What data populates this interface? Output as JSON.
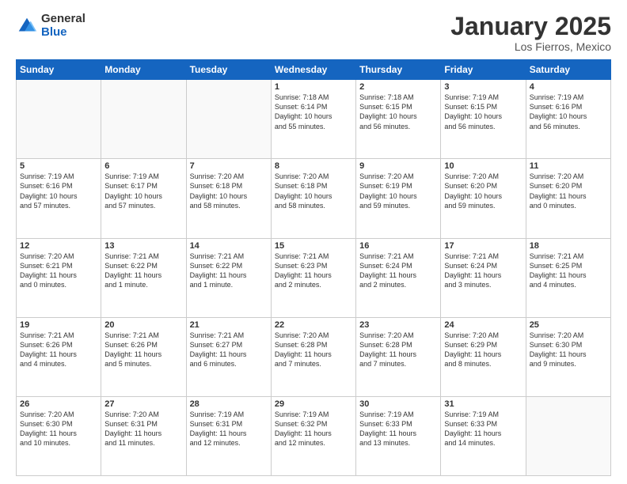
{
  "header": {
    "logo_general": "General",
    "logo_blue": "Blue",
    "month_title": "January 2025",
    "subtitle": "Los Fierros, Mexico"
  },
  "days_of_week": [
    "Sunday",
    "Monday",
    "Tuesday",
    "Wednesday",
    "Thursday",
    "Friday",
    "Saturday"
  ],
  "weeks": [
    [
      {
        "num": "",
        "info": ""
      },
      {
        "num": "",
        "info": ""
      },
      {
        "num": "",
        "info": ""
      },
      {
        "num": "1",
        "info": "Sunrise: 7:18 AM\nSunset: 6:14 PM\nDaylight: 10 hours\nand 55 minutes."
      },
      {
        "num": "2",
        "info": "Sunrise: 7:18 AM\nSunset: 6:15 PM\nDaylight: 10 hours\nand 56 minutes."
      },
      {
        "num": "3",
        "info": "Sunrise: 7:19 AM\nSunset: 6:15 PM\nDaylight: 10 hours\nand 56 minutes."
      },
      {
        "num": "4",
        "info": "Sunrise: 7:19 AM\nSunset: 6:16 PM\nDaylight: 10 hours\nand 56 minutes."
      }
    ],
    [
      {
        "num": "5",
        "info": "Sunrise: 7:19 AM\nSunset: 6:16 PM\nDaylight: 10 hours\nand 57 minutes."
      },
      {
        "num": "6",
        "info": "Sunrise: 7:19 AM\nSunset: 6:17 PM\nDaylight: 10 hours\nand 57 minutes."
      },
      {
        "num": "7",
        "info": "Sunrise: 7:20 AM\nSunset: 6:18 PM\nDaylight: 10 hours\nand 58 minutes."
      },
      {
        "num": "8",
        "info": "Sunrise: 7:20 AM\nSunset: 6:18 PM\nDaylight: 10 hours\nand 58 minutes."
      },
      {
        "num": "9",
        "info": "Sunrise: 7:20 AM\nSunset: 6:19 PM\nDaylight: 10 hours\nand 59 minutes."
      },
      {
        "num": "10",
        "info": "Sunrise: 7:20 AM\nSunset: 6:20 PM\nDaylight: 10 hours\nand 59 minutes."
      },
      {
        "num": "11",
        "info": "Sunrise: 7:20 AM\nSunset: 6:20 PM\nDaylight: 11 hours\nand 0 minutes."
      }
    ],
    [
      {
        "num": "12",
        "info": "Sunrise: 7:20 AM\nSunset: 6:21 PM\nDaylight: 11 hours\nand 0 minutes."
      },
      {
        "num": "13",
        "info": "Sunrise: 7:21 AM\nSunset: 6:22 PM\nDaylight: 11 hours\nand 1 minute."
      },
      {
        "num": "14",
        "info": "Sunrise: 7:21 AM\nSunset: 6:22 PM\nDaylight: 11 hours\nand 1 minute."
      },
      {
        "num": "15",
        "info": "Sunrise: 7:21 AM\nSunset: 6:23 PM\nDaylight: 11 hours\nand 2 minutes."
      },
      {
        "num": "16",
        "info": "Sunrise: 7:21 AM\nSunset: 6:24 PM\nDaylight: 11 hours\nand 2 minutes."
      },
      {
        "num": "17",
        "info": "Sunrise: 7:21 AM\nSunset: 6:24 PM\nDaylight: 11 hours\nand 3 minutes."
      },
      {
        "num": "18",
        "info": "Sunrise: 7:21 AM\nSunset: 6:25 PM\nDaylight: 11 hours\nand 4 minutes."
      }
    ],
    [
      {
        "num": "19",
        "info": "Sunrise: 7:21 AM\nSunset: 6:26 PM\nDaylight: 11 hours\nand 4 minutes."
      },
      {
        "num": "20",
        "info": "Sunrise: 7:21 AM\nSunset: 6:26 PM\nDaylight: 11 hours\nand 5 minutes."
      },
      {
        "num": "21",
        "info": "Sunrise: 7:21 AM\nSunset: 6:27 PM\nDaylight: 11 hours\nand 6 minutes."
      },
      {
        "num": "22",
        "info": "Sunrise: 7:20 AM\nSunset: 6:28 PM\nDaylight: 11 hours\nand 7 minutes."
      },
      {
        "num": "23",
        "info": "Sunrise: 7:20 AM\nSunset: 6:28 PM\nDaylight: 11 hours\nand 7 minutes."
      },
      {
        "num": "24",
        "info": "Sunrise: 7:20 AM\nSunset: 6:29 PM\nDaylight: 11 hours\nand 8 minutes."
      },
      {
        "num": "25",
        "info": "Sunrise: 7:20 AM\nSunset: 6:30 PM\nDaylight: 11 hours\nand 9 minutes."
      }
    ],
    [
      {
        "num": "26",
        "info": "Sunrise: 7:20 AM\nSunset: 6:30 PM\nDaylight: 11 hours\nand 10 minutes."
      },
      {
        "num": "27",
        "info": "Sunrise: 7:20 AM\nSunset: 6:31 PM\nDaylight: 11 hours\nand 11 minutes."
      },
      {
        "num": "28",
        "info": "Sunrise: 7:19 AM\nSunset: 6:31 PM\nDaylight: 11 hours\nand 12 minutes."
      },
      {
        "num": "29",
        "info": "Sunrise: 7:19 AM\nSunset: 6:32 PM\nDaylight: 11 hours\nand 12 minutes."
      },
      {
        "num": "30",
        "info": "Sunrise: 7:19 AM\nSunset: 6:33 PM\nDaylight: 11 hours\nand 13 minutes."
      },
      {
        "num": "31",
        "info": "Sunrise: 7:19 AM\nSunset: 6:33 PM\nDaylight: 11 hours\nand 14 minutes."
      },
      {
        "num": "",
        "info": ""
      }
    ]
  ]
}
